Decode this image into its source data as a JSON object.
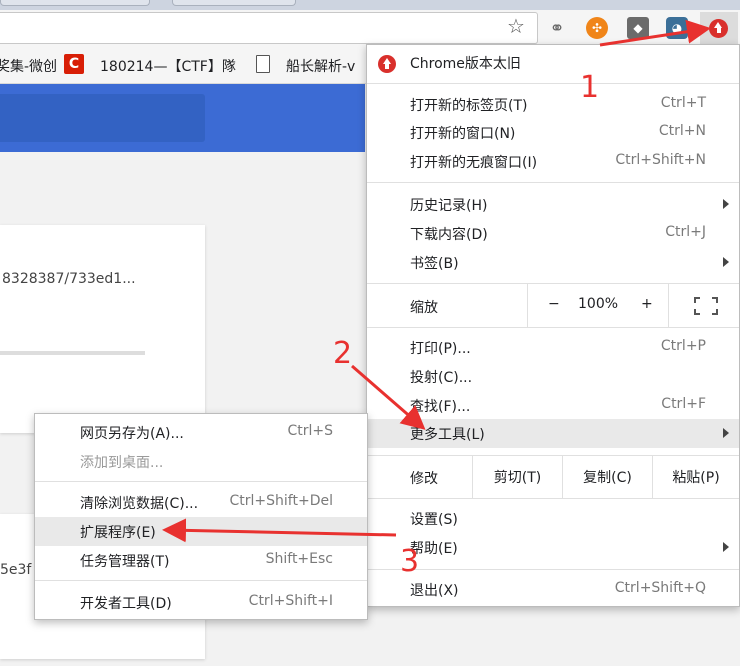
{
  "bookmarks": {
    "item1": "奖集-微创",
    "item2": "180214—【CTF】隊",
    "item3": "船长解析-v"
  },
  "page": {
    "card1_text": "8328387/733ed1...",
    "card2_text": "5e3f"
  },
  "menu": {
    "update": "Chrome版本太旧",
    "new_tab": {
      "label": "打开新的标签页(T)",
      "shortcut": "Ctrl+T"
    },
    "new_window": {
      "label": "打开新的窗口(N)",
      "shortcut": "Ctrl+N"
    },
    "incognito": {
      "label": "打开新的无痕窗口(I)",
      "shortcut": "Ctrl+Shift+N"
    },
    "history": {
      "label": "历史记录(H)"
    },
    "downloads": {
      "label": "下载内容(D)",
      "shortcut": "Ctrl+J"
    },
    "bookmarks": {
      "label": "书签(B)"
    },
    "zoom": {
      "label": "缩放",
      "minus": "−",
      "value": "100%",
      "plus": "+"
    },
    "print": {
      "label": "打印(P)...",
      "shortcut": "Ctrl+P"
    },
    "cast": {
      "label": "投射(C)..."
    },
    "find": {
      "label": "查找(F)...",
      "shortcut": "Ctrl+F"
    },
    "more_tools": {
      "label": "更多工具(L)"
    },
    "edit": {
      "label": "修改",
      "cut": "剪切(T)",
      "copy": "复制(C)",
      "paste": "粘贴(P)"
    },
    "settings": {
      "label": "设置(S)"
    },
    "help": {
      "label": "帮助(E)"
    },
    "exit": {
      "label": "退出(X)",
      "shortcut": "Ctrl+Shift+Q"
    }
  },
  "submenu": {
    "save_as": {
      "label": "网页另存为(A)...",
      "shortcut": "Ctrl+S"
    },
    "add_desktop": {
      "label": "添加到桌面..."
    },
    "clear_data": {
      "label": "清除浏览数据(C)...",
      "shortcut": "Ctrl+Shift+Del"
    },
    "extensions": {
      "label": "扩展程序(E)"
    },
    "task_manager": {
      "label": "任务管理器(T)",
      "shortcut": "Shift+Esc"
    },
    "dev_tools": {
      "label": "开发者工具(D)",
      "shortcut": "Ctrl+Shift+I"
    }
  },
  "annotations": {
    "n1": "1",
    "n2": "2",
    "n3": "3"
  },
  "colors": {
    "annotation": "#e8312f",
    "page_blue": "#3c6bd4"
  }
}
